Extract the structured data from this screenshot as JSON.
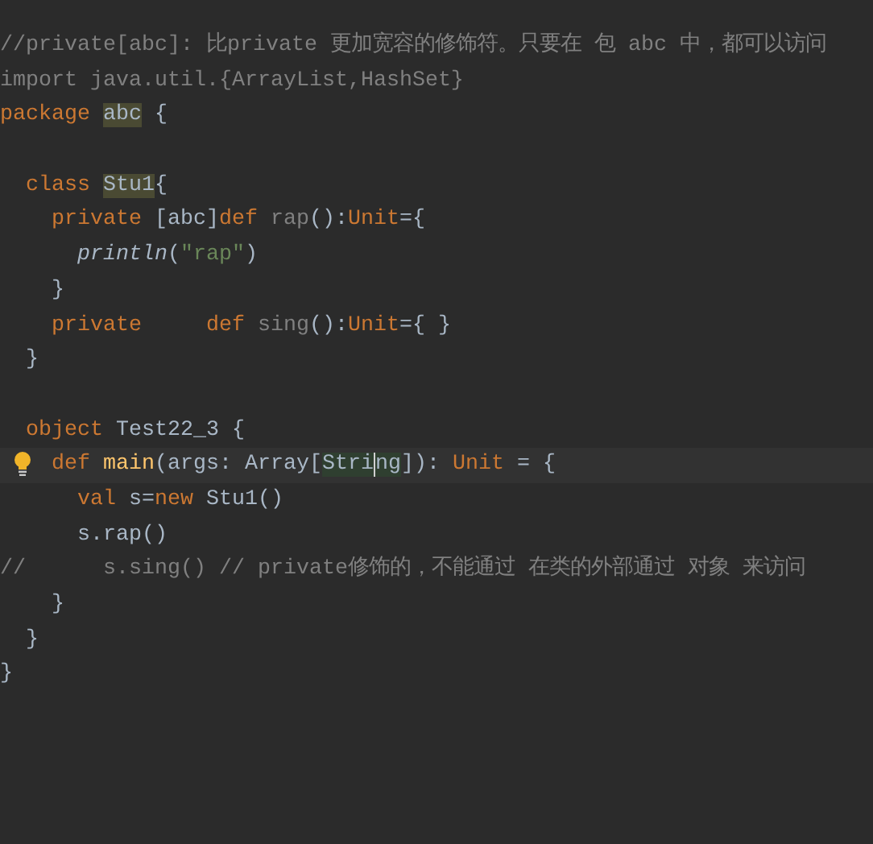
{
  "editor": {
    "lines": [
      {
        "tokens": [
          {
            "text": "//private[abc]: 比private 更加宽容的修饰符。只要在 包 abc 中，都可以访问",
            "kind": "comment"
          }
        ]
      },
      {
        "tokens": [
          {
            "text": "import java.util.{ArrayList,HashSet}",
            "kind": "comment"
          }
        ]
      },
      {
        "tokens": [
          {
            "text": "package ",
            "kind": "keyword"
          },
          {
            "text": "abc",
            "kind": "usage"
          },
          {
            "text": " {",
            "kind": "plain"
          }
        ]
      },
      {
        "blank_before": true,
        "tokens": [
          {
            "text": "  class ",
            "kind": "keyword"
          },
          {
            "text": "Stu1",
            "kind": "usage"
          },
          {
            "text": "{",
            "kind": "plain"
          }
        ]
      },
      {
        "tokens": [
          {
            "text": "    private ",
            "kind": "keyword"
          },
          {
            "text": "[abc]",
            "kind": "plain"
          },
          {
            "text": "def ",
            "kind": "keyword"
          },
          {
            "text": "rap",
            "kind": "unused"
          },
          {
            "text": "():",
            "kind": "plain"
          },
          {
            "text": "Unit",
            "kind": "keyword"
          },
          {
            "text": "={",
            "kind": "plain"
          }
        ]
      },
      {
        "tokens": [
          {
            "text": "      println",
            "kind": "call"
          },
          {
            "text": "(",
            "kind": "plain"
          },
          {
            "text": "\"rap\"",
            "kind": "string"
          },
          {
            "text": ")",
            "kind": "plain"
          }
        ]
      },
      {
        "tokens": [
          {
            "text": "    }",
            "kind": "plain"
          }
        ]
      },
      {
        "tokens": [
          {
            "text": "    private     def ",
            "kind": "keyword"
          },
          {
            "text": "sing",
            "kind": "unused"
          },
          {
            "text": "():",
            "kind": "plain"
          },
          {
            "text": "Unit",
            "kind": "keyword"
          },
          {
            "text": "={ }",
            "kind": "plain"
          }
        ]
      },
      {
        "tokens": [
          {
            "text": "  }",
            "kind": "plain"
          }
        ]
      },
      {
        "blank_before": true,
        "tokens": [
          {
            "text": "  object ",
            "kind": "keyword"
          },
          {
            "text": "Test22_3 {",
            "kind": "plain"
          }
        ]
      },
      {
        "current": true,
        "intention_bulb": true,
        "tokens": [
          {
            "text": "    def ",
            "kind": "keyword"
          },
          {
            "text": "main",
            "kind": "function"
          },
          {
            "text": "(args: Array[",
            "kind": "plain"
          },
          {
            "text": "Stri",
            "kind": "match",
            "caret": true
          },
          {
            "text": "ng",
            "kind": "match"
          },
          {
            "text": "]): ",
            "kind": "plain"
          },
          {
            "text": "Unit",
            "kind": "keyword"
          },
          {
            "text": " = {",
            "kind": "plain"
          }
        ]
      },
      {
        "tokens": [
          {
            "text": "      val ",
            "kind": "keyword"
          },
          {
            "text": "s=",
            "kind": "plain"
          },
          {
            "text": "new ",
            "kind": "keyword"
          },
          {
            "text": "Stu1()",
            "kind": "plain"
          }
        ]
      },
      {
        "tokens": [
          {
            "text": "      s.rap()",
            "kind": "plain"
          }
        ]
      },
      {
        "tokens": [
          {
            "text": "//      s.sing() // private修饰的，不能通过 在类的外部通过 对象 来访问",
            "kind": "comment"
          }
        ]
      },
      {
        "tokens": [
          {
            "text": "    }",
            "kind": "plain"
          }
        ]
      },
      {
        "tokens": [
          {
            "text": "  }",
            "kind": "plain"
          }
        ]
      },
      {
        "tokens": [
          {
            "text": "}",
            "kind": "plain"
          }
        ]
      }
    ]
  }
}
